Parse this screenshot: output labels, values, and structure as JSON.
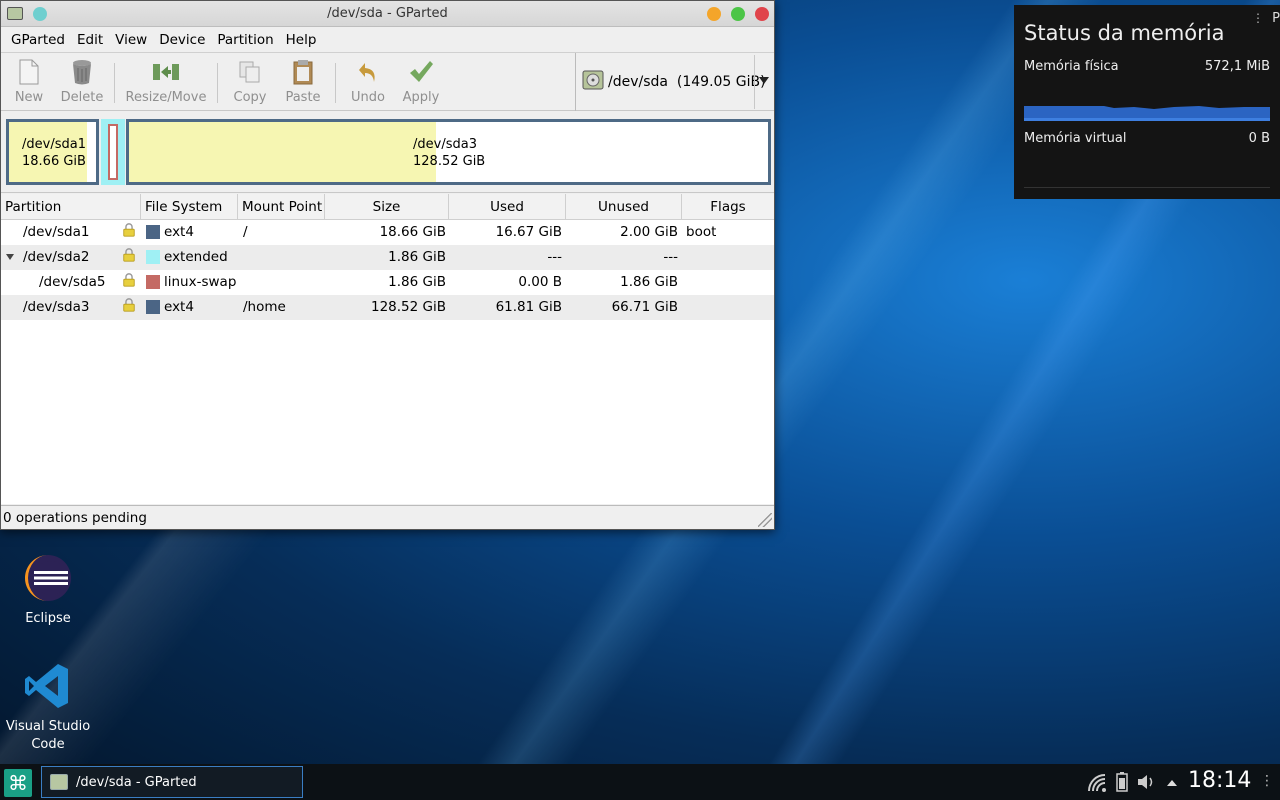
{
  "window": {
    "title": "/dev/sda - GParted",
    "menu": [
      "GParted",
      "Edit",
      "View",
      "Device",
      "Partition",
      "Help"
    ],
    "toolbar": {
      "new": "New",
      "delete": "Delete",
      "resize_move": "Resize/Move",
      "copy": "Copy",
      "paste": "Paste",
      "undo": "Undo",
      "apply": "Apply"
    },
    "device_selector": "/dev/sda  (149.05 GiB)"
  },
  "disk_map": {
    "sda1": {
      "name": "/dev/sda1",
      "size": "18.66 GiB",
      "used_fraction": 0.893
    },
    "sda3": {
      "name": "/dev/sda3",
      "size": "128.52 GiB",
      "used_fraction": 0.481
    }
  },
  "table": {
    "columns": [
      "Partition",
      "File System",
      "Mount Point",
      "Size",
      "Used",
      "Unused",
      "Flags"
    ],
    "rows": [
      {
        "partition": "/dev/sda1",
        "fs": "ext4",
        "fs_color": "#4b6585",
        "mount": "/",
        "size": "18.66 GiB",
        "used": "16.67 GiB",
        "unused": "2.00 GiB",
        "flags": "boot"
      },
      {
        "partition": "/dev/sda2",
        "fs": "extended",
        "fs_color": "#9ff0f4",
        "mount": "",
        "size": "1.86 GiB",
        "used": "---",
        "unused": "---",
        "flags": ""
      },
      {
        "partition": "/dev/sda5",
        "fs": "linux-swap",
        "fs_color": "#c46a64",
        "mount": "",
        "size": "1.86 GiB",
        "used": "0.00 B",
        "unused": "1.86 GiB",
        "flags": ""
      },
      {
        "partition": "/dev/sda3",
        "fs": "ext4",
        "fs_color": "#4b6585",
        "mount": "/home",
        "size": "128.52 GiB",
        "used": "61.81 GiB",
        "unused": "66.71 GiB",
        "flags": ""
      }
    ]
  },
  "status": "0 operations pending",
  "memory_widget": {
    "title": "Status da memória",
    "physical_label": "Memória física",
    "physical_value": "572,1 MiB",
    "virtual_label": "Memória virtual",
    "virtual_value": "0 B",
    "corner_char": "P"
  },
  "desktop_icons": {
    "eclipse": "Eclipse",
    "vscode": "Visual Studio Code"
  },
  "taskbar": {
    "task_title": "/dev/sda - GParted",
    "clock": "18:14"
  }
}
